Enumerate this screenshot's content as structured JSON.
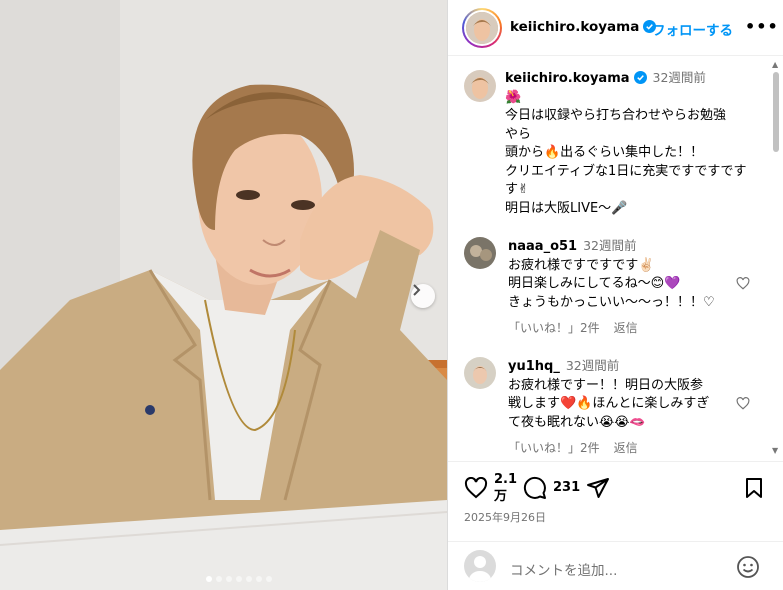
{
  "post": {
    "username": "keiichiro.koyama",
    "follow_label": "フォローする",
    "more_label": "•••",
    "photo_alt": "selfie photo",
    "carousel_dots": 7,
    "carousel_active": 0
  },
  "caption": {
    "username": "keiichiro.koyama",
    "time": "32週間前",
    "emoji_line": "🌺",
    "lines": [
      "今日は収録やら打ち合わせやらお勉強",
      "やら",
      "頭から🔥出るぐらい集中した！！",
      "クリエイティブな1日に充実ですですです",
      "す✌",
      "明日は大阪LIVE〜🎤"
    ]
  },
  "comments": [
    {
      "username": "naaa_o51",
      "time": "32週間前",
      "lines": [
        "お疲れ様ですですです✌🏻",
        "明日楽しみにしてるね〜😊💜",
        "きょうもかっこいい〜〜っ！！！♡"
      ],
      "likes": "「いいね！」2件",
      "reply": "返信"
    },
    {
      "username": "yu1hq_",
      "time": "32週間前",
      "lines": [
        "お疲れ様ですー！！明日の大阪参",
        "戦します❤️🔥ほんとに楽しみすぎ",
        "て夜も眠れない😭😭🫦"
      ],
      "likes": "「いいね！」2件",
      "reply": "返信"
    }
  ],
  "actions": {
    "likes_count_line1": "2.1",
    "likes_count_line2": "万",
    "comments_count": "231",
    "date": "2025年9月26日"
  },
  "add_comment": {
    "placeholder": "コメントを追加..."
  },
  "colors": {
    "accent": "#0095f6",
    "muted": "#737373",
    "border": "#dbdbdb"
  }
}
